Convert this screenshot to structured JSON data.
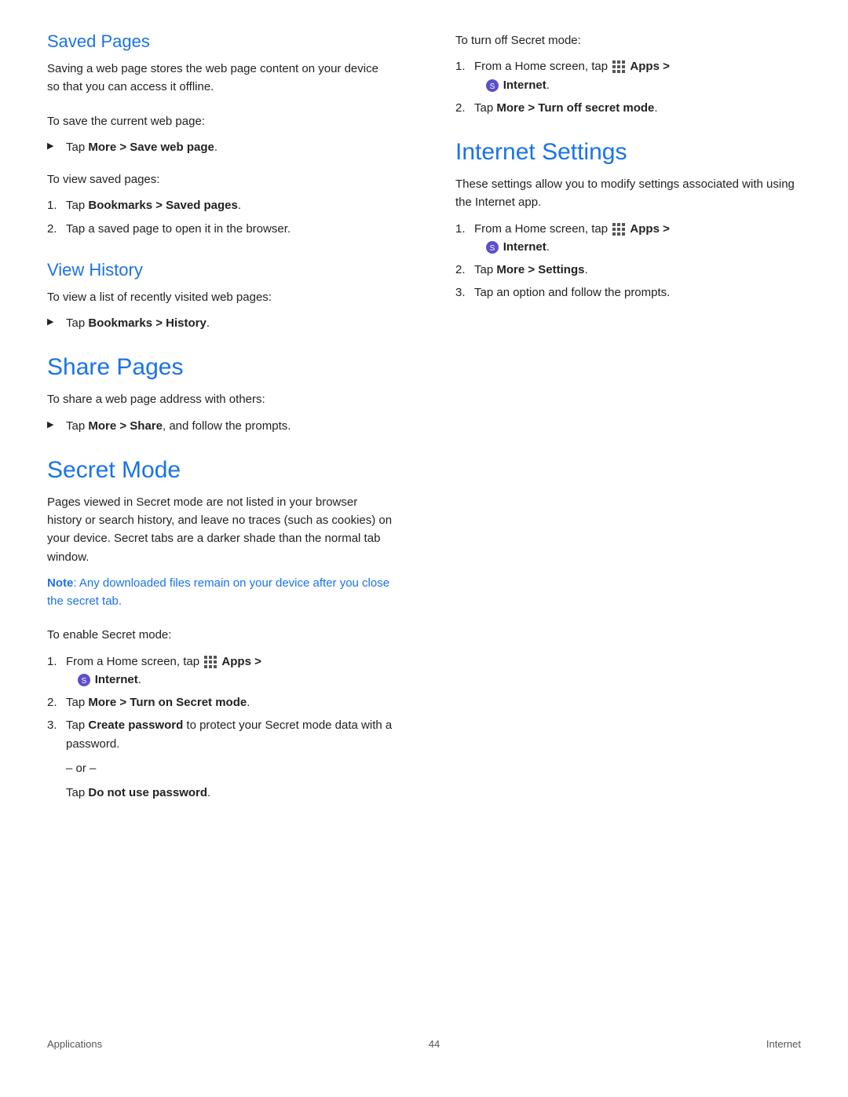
{
  "page": {
    "footer": {
      "left": "Applications",
      "center": "44",
      "right": "Internet"
    }
  },
  "left": {
    "savedPages": {
      "heading": "Saved Pages",
      "intro": "Saving a web page stores the web page content on your device so that you can access it offline.",
      "saveInstruction": "To save the current web page:",
      "saveBullet": "Tap More > Save web page.",
      "viewInstruction": "To view saved pages:",
      "viewStep1": "Tap Bookmarks > Saved pages.",
      "viewStep2": "Tap a saved page to open it in the browser."
    },
    "viewHistory": {
      "heading": "View History",
      "intro": "To view a list of recently visited web pages:",
      "bullet": "Tap Bookmarks > History."
    },
    "sharePages": {
      "heading": "Share Pages",
      "intro": "To share a web page address with others:",
      "bullet": "Tap More > Share, and follow the prompts."
    },
    "secretMode": {
      "heading": "Secret Mode",
      "intro": "Pages viewed in Secret mode are not listed in your browser history or search history, and leave no traces (such as cookies) on your device. Secret tabs are a darker shade than the normal tab window.",
      "note": "Note: Any downloaded files remain on your device after you close the secret tab.",
      "enableInstruction": "To enable Secret mode:",
      "step1a": "From a Home screen, tap",
      "step1b": "Apps >",
      "step1c": "Internet.",
      "step2": "Tap More > Turn on Secret mode.",
      "step3a": "Tap",
      "step3b": "Create password",
      "step3c": "to protect your Secret mode data with a password.",
      "or": "– or –",
      "tapText": "Tap",
      "doNotUse": "Do not use password."
    }
  },
  "right": {
    "secretModeOff": {
      "intro": "To turn off Secret mode:",
      "step1a": "From a Home screen, tap",
      "step1b": "Apps >",
      "step1c": "Internet.",
      "step2": "Tap More > Turn off secret mode."
    },
    "internetSettings": {
      "heading": "Internet Settings",
      "intro": "These settings allow you to modify settings associated with using the Internet app.",
      "step1a": "From a Home screen, tap",
      "step1b": "Apps >",
      "step1c": "Internet.",
      "step2": "Tap More > Settings.",
      "step3": "Tap an option and follow the prompts."
    }
  }
}
